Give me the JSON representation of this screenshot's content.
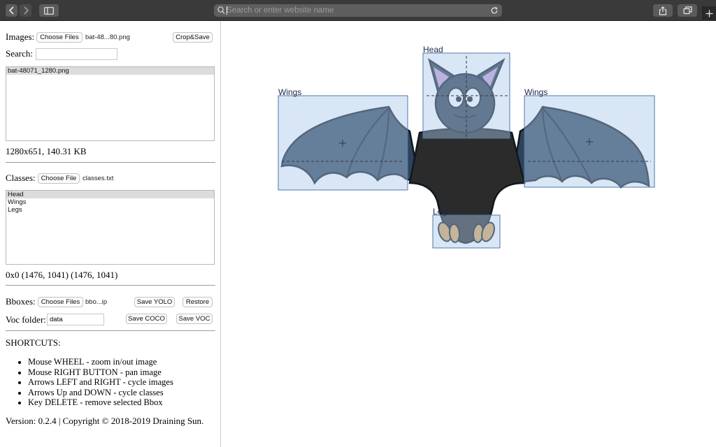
{
  "browser": {
    "address_placeholder": "Search or enter website name",
    "icons": {
      "back": "chevron-left-icon",
      "forward": "chevron-right-icon",
      "sidebar": "sidebar-icon",
      "search": "search-icon",
      "reload": "reload-icon",
      "share": "share-icon",
      "tabs": "tabs-overview-icon",
      "new_tab": "plus-icon"
    }
  },
  "images": {
    "label": "Images:",
    "choose_label": "Choose Files",
    "file_name": "bat-48...80.png",
    "crop_label": "Crop&Save",
    "search_label": "Search:",
    "search_value": "",
    "list": [
      "bat-48071_1280.png"
    ],
    "info": "1280x651, 140.31 KB"
  },
  "classes": {
    "label": "Classes:",
    "choose_label": "Choose File",
    "file_name": "classes.txt",
    "list": [
      "Head",
      "Wings",
      "Legs"
    ],
    "info": "0x0 (1476, 1041) (1476, 1041)"
  },
  "bboxes": {
    "label": "Bboxes:",
    "choose_label": "Choose Files",
    "file_name": "bbo...ip",
    "save_yolo": "Save YOLO",
    "restore": "Restore",
    "voc_label": "Voc folder:",
    "voc_value": "data",
    "save_coco": "Save COCO",
    "save_voc": "Save VOC"
  },
  "shortcuts": {
    "title": "SHORTCUTS:",
    "items": [
      "Mouse WHEEL - zoom in/out image",
      "Mouse RIGHT BUTTON - pan image",
      "Arrows LEFT and RIGHT - cycle images",
      "Arrows Up and DOWN - cycle classes",
      "Key DELETE - remove selected Bbox"
    ]
  },
  "footer": "Version: 0.2.4 | Copyright © 2018-2019 Draining Sun.",
  "canvas": {
    "annotations": [
      {
        "label": "Head"
      },
      {
        "label": "Wings"
      },
      {
        "label": "Wings"
      },
      {
        "label": "Legs"
      }
    ],
    "colors": {
      "bbox_fill": "#a8c8ec",
      "bbox_stroke": "#4f78a8",
      "bat_body": "#2b3a4a",
      "bat_wing": "#2e4258",
      "bat_ear_inner": "#c9a1d6",
      "bat_feet": "#d9a55a"
    }
  }
}
